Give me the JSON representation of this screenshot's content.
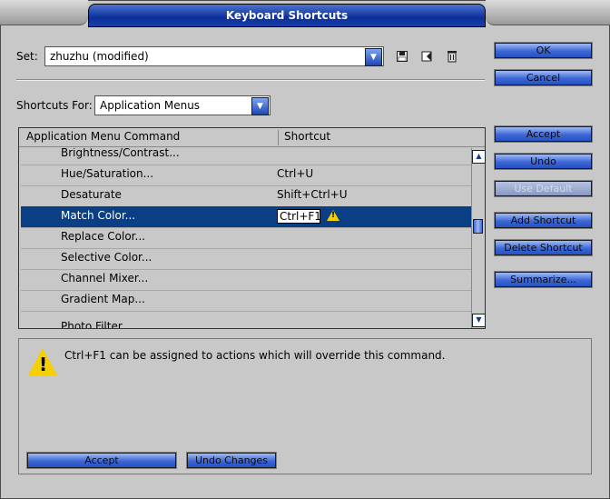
{
  "window": {
    "title": "Keyboard Shortcuts"
  },
  "set": {
    "label": "Set:",
    "value": "zhuzhu (modified)",
    "icons": [
      "save-icon",
      "new-set-icon",
      "delete-icon"
    ]
  },
  "shortcuts_for": {
    "label": "Shortcuts For:",
    "value": "Application Menus"
  },
  "table": {
    "headers": [
      "Application Menu Command",
      "Shortcut"
    ],
    "rows": [
      {
        "command": "Brightness/Contrast...",
        "shortcut": ""
      },
      {
        "command": "Hue/Saturation...",
        "shortcut": "Ctrl+U"
      },
      {
        "command": "Desaturate",
        "shortcut": "Shift+Ctrl+U"
      },
      {
        "command": "Match Color...",
        "shortcut": "Ctrl+F1",
        "selected": true,
        "warning": true
      },
      {
        "command": "Replace Color...",
        "shortcut": ""
      },
      {
        "command": "Selective Color...",
        "shortcut": ""
      },
      {
        "command": "Channel Mixer...",
        "shortcut": ""
      },
      {
        "command": "Gradient Map...",
        "shortcut": ""
      },
      {
        "command": "Photo Filter...",
        "shortcut": ""
      }
    ]
  },
  "buttons": {
    "ok": "OK",
    "cancel": "Cancel",
    "accept": "Accept",
    "undo": "Undo",
    "use_default": "Use Default",
    "add_shortcut": "Add Shortcut",
    "delete_shortcut": "Delete Shortcut",
    "summarize": "Summarize..."
  },
  "message": {
    "text": "Ctrl+F1 can be assigned to actions which will override this command.",
    "accept": "Accept",
    "undo_changes": "Undo Changes"
  },
  "colors": {
    "title_bar": "#0b2f99",
    "selection": "#0a3f86",
    "button": "#3d67d4",
    "warning": "#f4d000"
  }
}
